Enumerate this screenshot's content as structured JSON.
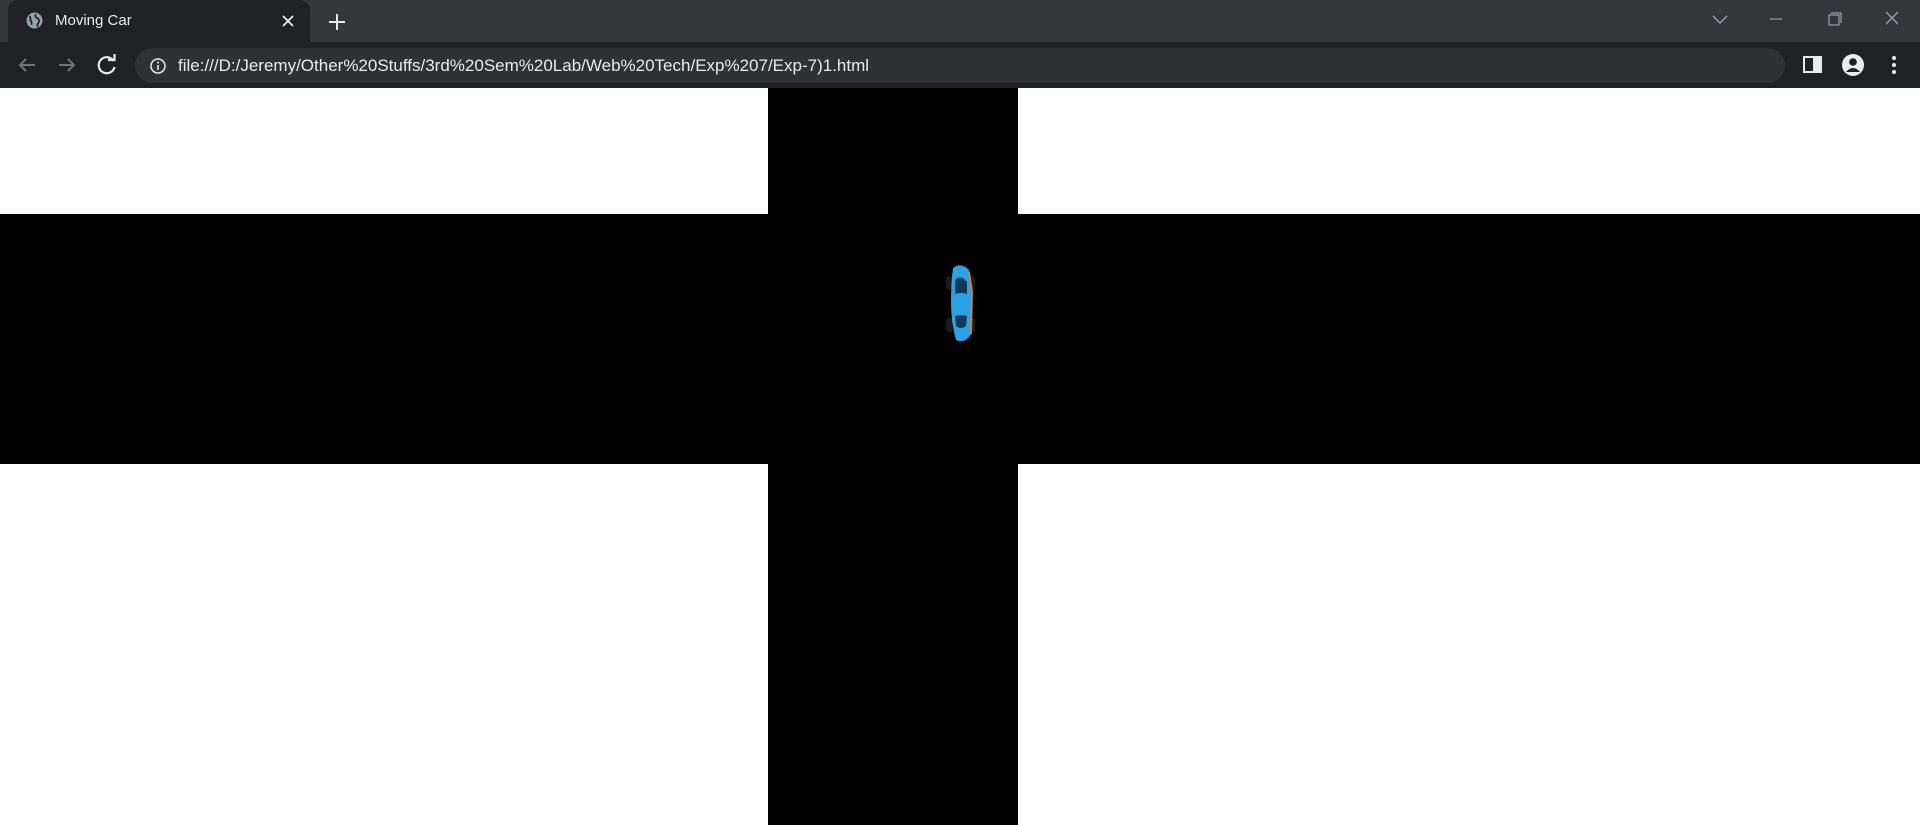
{
  "browser": {
    "tab": {
      "title": "Moving Car"
    },
    "url": "file:///D:/Jeremy/Other%20Stuffs/3rd%20Sem%20Lab/Web%20Tech/Exp%207/Exp-7)1.html"
  },
  "page": {
    "road_color": "#000000",
    "background_color": "#ffffff",
    "car_color": "#29a3e6"
  }
}
